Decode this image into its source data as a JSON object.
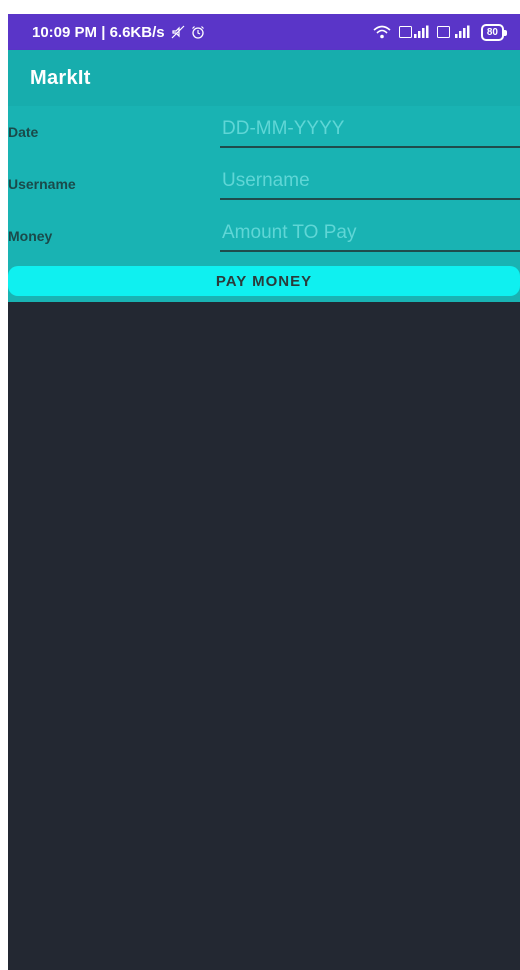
{
  "status_bar": {
    "time_and_speed": "10:09 PM | 6.6KB/s",
    "battery": "80"
  },
  "app_bar": {
    "title": "MarkIt"
  },
  "form": {
    "date": {
      "label": "Date",
      "placeholder": "DD-MM-YYYY",
      "value": ""
    },
    "username": {
      "label": "Username",
      "placeholder": "Username",
      "value": ""
    },
    "money": {
      "label": "Money",
      "placeholder": "Amount TO Pay",
      "value": ""
    },
    "pay_button_label": "PAY MONEY"
  },
  "colors": {
    "status_bar": "#5a35c8",
    "app_bar": "#17adad",
    "form_bg": "#19b3b3",
    "button": "#0ff0f0",
    "screen_bg": "#232832"
  }
}
